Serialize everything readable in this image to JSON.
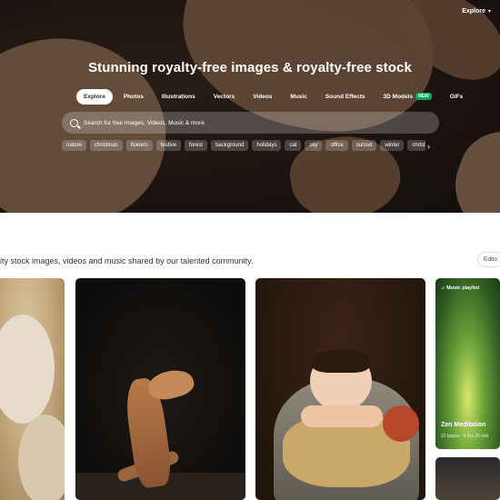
{
  "nav": {
    "explore_label": "Explore"
  },
  "hero": {
    "title": "Stunning royalty-free images & royalty-free stock",
    "tabs": [
      {
        "label": "Explore",
        "active": true
      },
      {
        "label": "Photos"
      },
      {
        "label": "Illustrations"
      },
      {
        "label": "Vectors"
      },
      {
        "label": "Videos"
      },
      {
        "label": "Music"
      },
      {
        "label": "Sound Effects"
      },
      {
        "label": "3D Models",
        "badge": "NEW"
      },
      {
        "label": "GIFs"
      }
    ],
    "search_placeholder": "Search for free Images, Videos, Music & more",
    "tags": [
      "nature",
      "christmas",
      "flowers",
      "festive",
      "forest",
      "background",
      "holidays",
      "cat",
      "sky",
      "office",
      "sunset",
      "winter",
      "christm"
    ]
  },
  "content": {
    "tagline": "ity stock images, videos and music shared by our talented community.",
    "editors_label": "Edito"
  },
  "gallery": {
    "playlist_badge": "Music playlist",
    "playlist_title": "Zen Meditation",
    "playlist_meta": "31 tracks · 5 hrs 25 min"
  },
  "colors": {
    "new_badge": "#02a95c"
  }
}
